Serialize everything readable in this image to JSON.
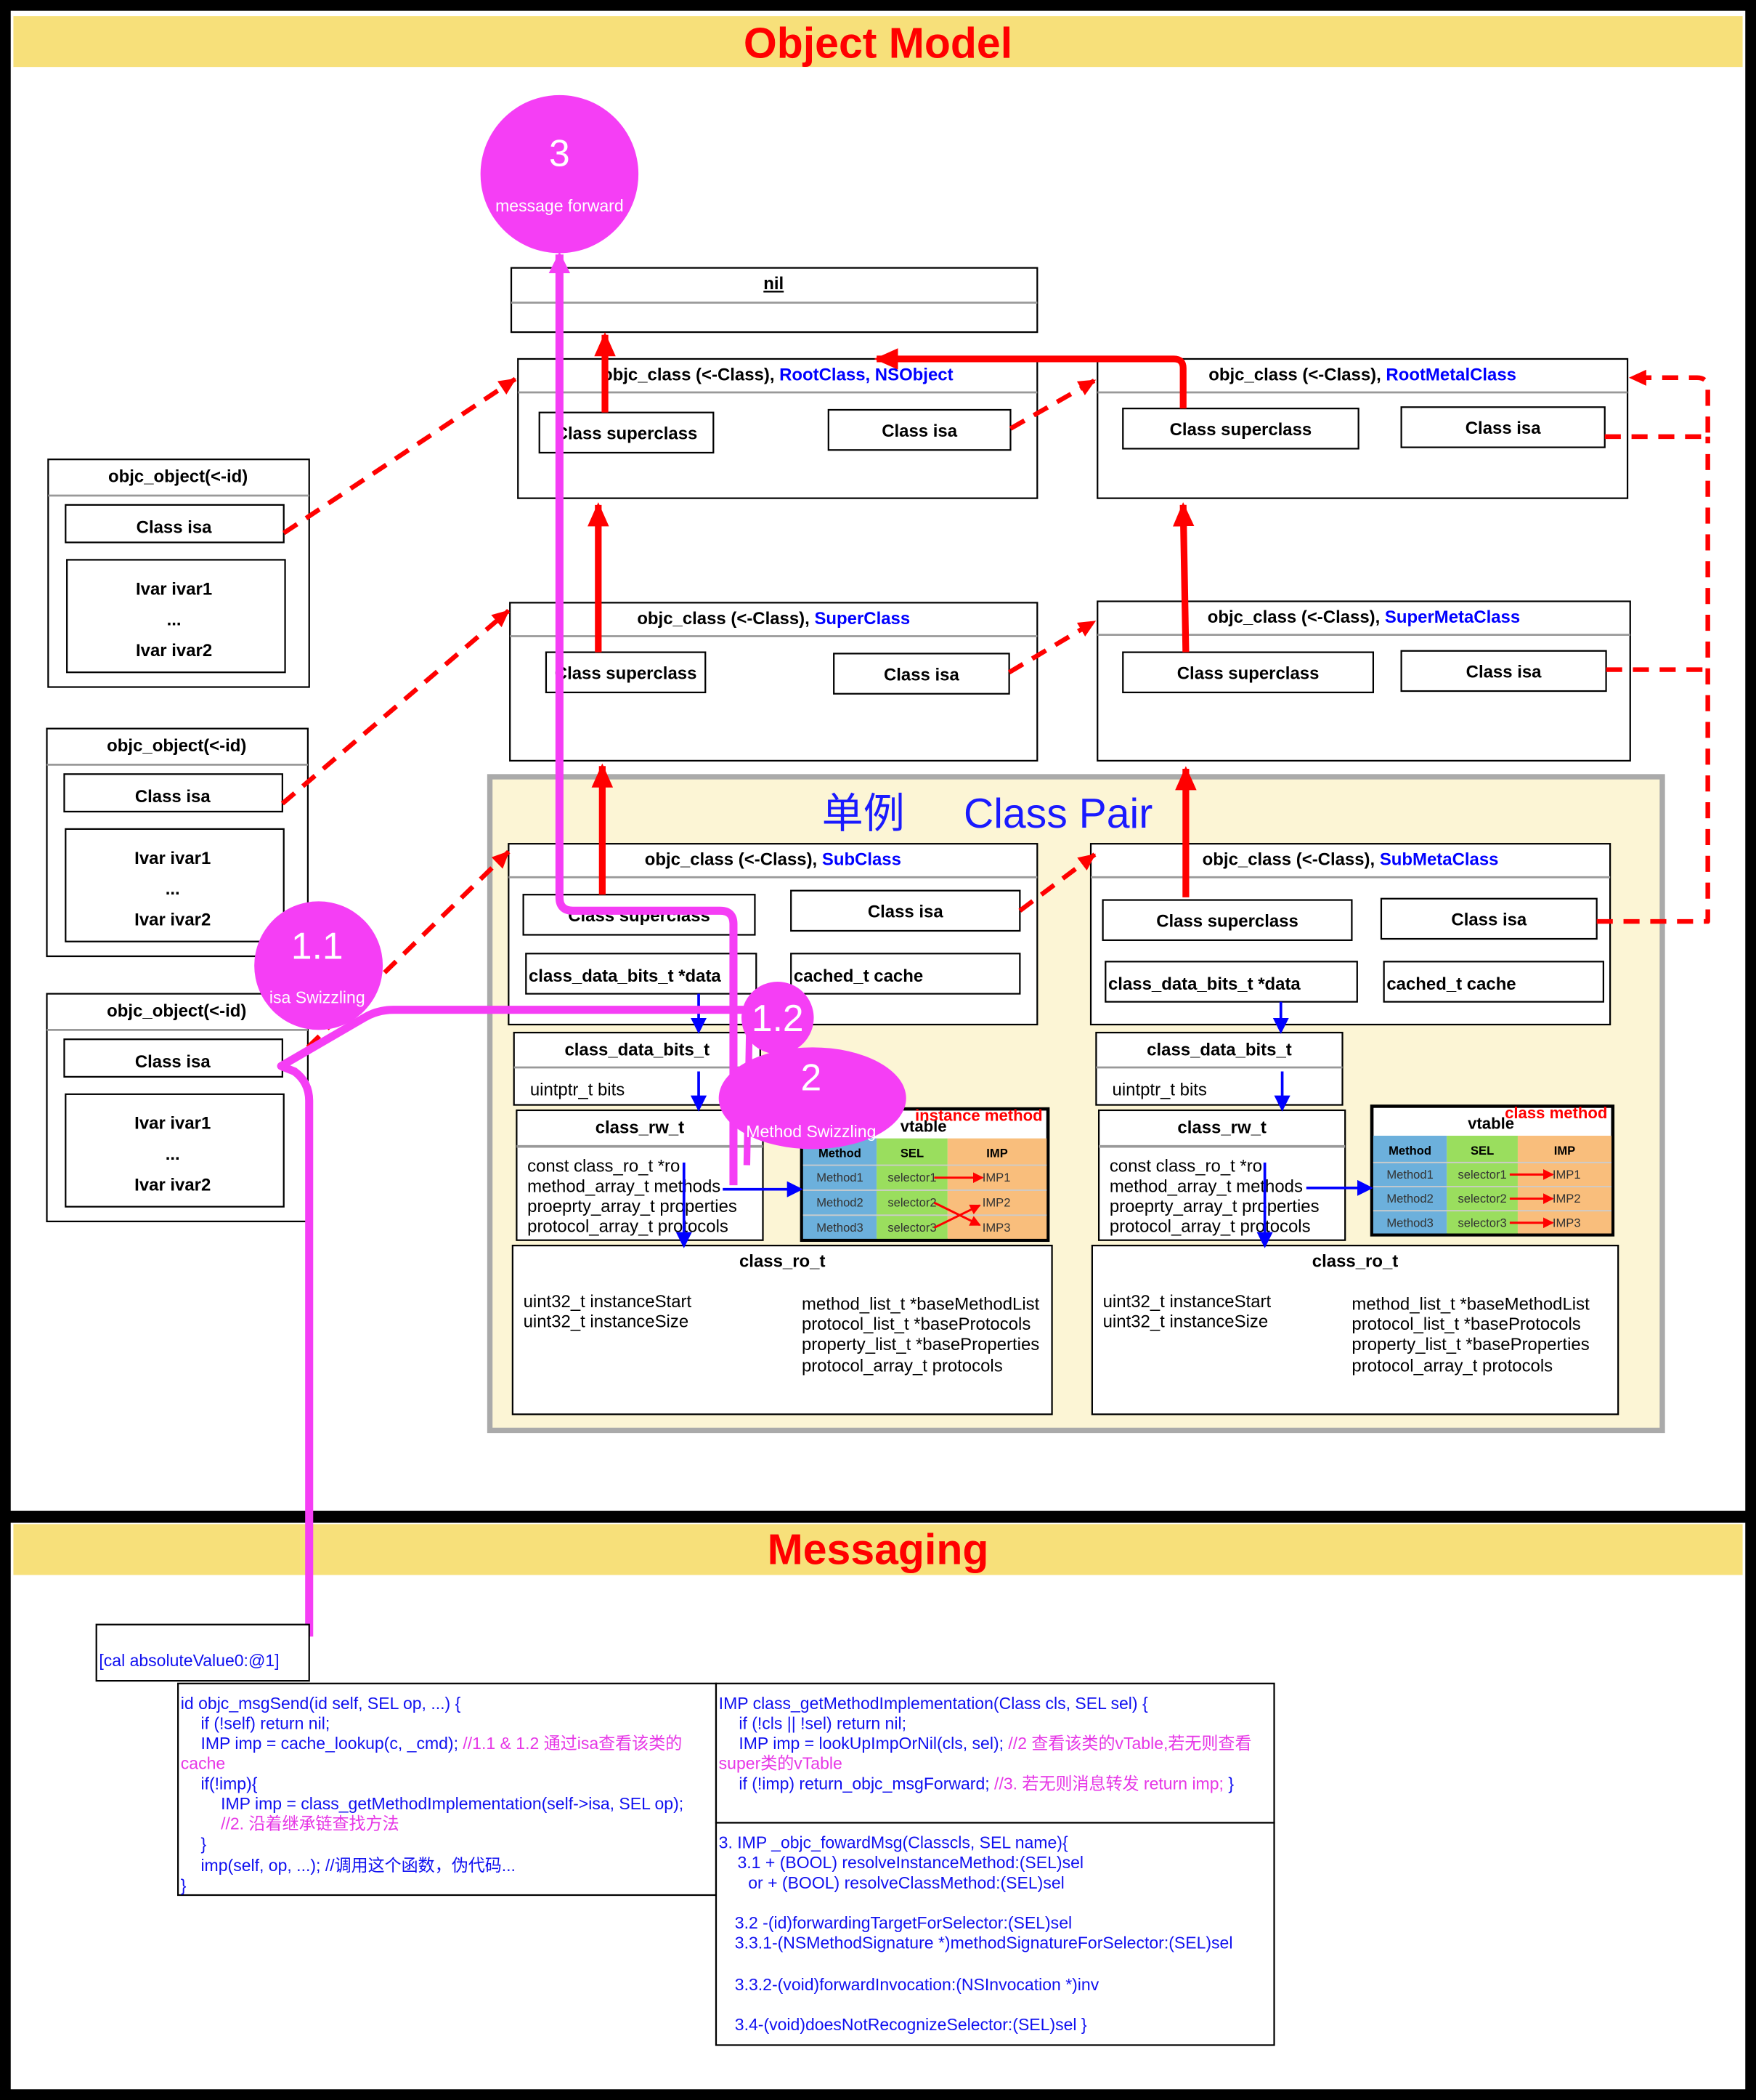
{
  "header": {
    "object_model": "Object Model",
    "messaging": "Messaging"
  },
  "class_pair": {
    "singleton": "单例",
    "title": "Class Pair"
  },
  "circles": {
    "forward": {
      "number": "3",
      "label": "message forward"
    },
    "isa_swizzling": {
      "number": "1.1",
      "label": "isa Swizzling"
    },
    "cache": {
      "number": "1.2"
    },
    "method_swizzling": {
      "number": "2",
      "label": "Method Swizzling"
    }
  },
  "nil_box": {
    "title": "nil"
  },
  "objects": [
    {
      "title": "objc_object(<-id)",
      "isa": "Class isa",
      "ivars": [
        "Ivar ivar1",
        "...",
        "Ivar ivar2"
      ]
    },
    {
      "title": "objc_object(<-id)",
      "isa": "Class isa",
      "ivars": [
        "Ivar ivar1",
        "...",
        "Ivar ivar2"
      ]
    },
    {
      "title": "objc_object(<-id)",
      "isa": "Class isa",
      "ivars": [
        "Ivar ivar1",
        "...",
        "Ivar ivar2"
      ]
    }
  ],
  "classes": {
    "root": {
      "prefix": "objc_class (<-Class), ",
      "name": "RootClass, NSObject",
      "superclass": "Class superclass",
      "isa": "Class isa"
    },
    "root_meta": {
      "prefix": "objc_class (<-Class), ",
      "name": "RootMetalClass",
      "superclass": "Class superclass",
      "isa": "Class isa"
    },
    "super": {
      "prefix": "objc_class (<-Class), ",
      "name": "SuperClass",
      "superclass": "Class superclass",
      "isa": "Class isa"
    },
    "super_meta": {
      "prefix": "objc_class (<-Class), ",
      "name": "SuperMetaClass",
      "superclass": "Class superclass",
      "isa": "Class isa"
    },
    "sub": {
      "prefix": "objc_class (<-Class), ",
      "name": "SubClass",
      "superclass": "Class superclass",
      "isa": "Class isa",
      "data": "class_data_bits_t *data",
      "cache": "cached_t cache"
    },
    "sub_meta": {
      "prefix": "objc_class (<-Class), ",
      "name": "SubMetaClass",
      "superclass": "Class superclass",
      "isa": "Class isa",
      "data": "class_data_bits_t *data",
      "cache": "cached_t cache"
    }
  },
  "data_bits": {
    "title": "class_data_bits_t",
    "field": "uintptr_t bits"
  },
  "rw": {
    "title": "class_rw_t",
    "fields": [
      "const class_ro_t *ro",
      "method_array_t methods",
      "proeprty_array_t properties",
      "protocol_array_t protocols"
    ]
  },
  "vtables": {
    "header": "vtable",
    "instance_label": "instance method",
    "class_label": "class method",
    "columns": [
      "Method",
      "SEL",
      "IMP"
    ],
    "rows": [
      [
        "Method1",
        "selector1",
        "IMP1"
      ],
      [
        "Method2",
        "selector2",
        "IMP2"
      ],
      [
        "Method3",
        "selector3",
        "IMP3"
      ]
    ]
  },
  "ro": {
    "title": "class_ro_t",
    "left": [
      "uint32_t instanceStart",
      "uint32_t instanceSize"
    ],
    "right": [
      "method_list_t *baseMethodList",
      "protocol_list_t *baseProtocols",
      "property_list_t *baseProperties",
      "protocol_array_t protocols"
    ]
  },
  "colors": {
    "header_band": "#f7e07a",
    "title_red": "#ff0000",
    "class_name_blue": "#0000ff",
    "class_pair_bg": "#fcf5d5",
    "swizzle_magenta": "#f53ef5",
    "method_col": "#6cb0dc",
    "sel_col": "#9ade5e",
    "imp_col": "#f9be7c"
  },
  "messaging": {
    "call": "[cal absoluteValue0:@1]",
    "msg_send": [
      [
        {
          "text": "id objc_msgSend(id self, SEL op, ...) {"
        }
      ],
      [
        {
          "text": "if (!self) return nil;"
        }
      ],
      [
        {
          "text": "IMP imp = cache_lookup(c, _cmd); "
        },
        {
          "text": "//1.1 & 1.2 通过isa查看该类的",
          "comment": true
        }
      ],
      [
        {
          "text": "cache",
          "comment": true
        }
      ],
      [
        {
          "text": "if(!imp){"
        }
      ],
      [
        {
          "text": "IMP imp = class_getMethodImplementation(self->isa, SEL op);"
        }
      ],
      [
        {
          "text": "//2. 沿着继承链查找方法",
          "comment": true
        }
      ],
      [
        {
          "text": "}"
        }
      ],
      [
        {
          "text": "imp(self, op, ...); //调用这个函数，伪代码..."
        }
      ],
      [
        {
          "text": "}"
        }
      ]
    ],
    "get_method_imp": [
      [
        {
          "text": "IMP class_getMethodImplementation(Class cls, SEL sel) {"
        }
      ],
      [
        {
          "text": "if (!cls || !sel) return nil;"
        }
      ],
      [
        {
          "text": "IMP imp = lookUpImpOrNil(cls, sel); "
        },
        {
          "text": "//2 查看该类的vTable,若无则查看",
          "comment": true
        }
      ],
      [
        {
          "text": "super类的vTable",
          "comment": true
        }
      ],
      [
        {
          "text": "if (!imp) return_objc_msgForward; "
        },
        {
          "text": "//3. 若无则消息转发 return imp;",
          "comment": true
        },
        {
          "text": " }"
        }
      ]
    ],
    "foward_msg": [
      [
        {
          "text": "3. IMP _objc_fowardMsg(Classcls, SEL name){"
        }
      ],
      [
        {
          "text": "3.1 + (BOOL) resolveInstanceMethod:(SEL)sel"
        }
      ],
      [
        {
          "text": "or + (BOOL) resolveClassMethod:(SEL)sel"
        }
      ],
      [
        {
          "text": "3.2 -(id)forwardingTargetForSelector:(SEL)sel"
        }
      ],
      [
        {
          "text": "3.3.1-(NSMethodSignature *)methodSignatureForSelector:(SEL)sel"
        }
      ],
      [
        {
          "text": "3.3.2-(void)forwardInvocation:(NSInvocation *)inv"
        }
      ],
      [
        {
          "text": "3.4-(void)doesNotRecognizeSelector:(SEL)sel }"
        }
      ]
    ]
  }
}
